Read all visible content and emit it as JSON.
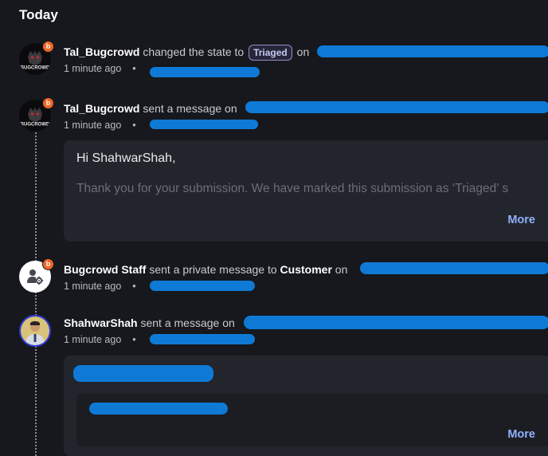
{
  "section": {
    "title": "Today"
  },
  "icons": {
    "badge_letter": "b"
  },
  "events": [
    {
      "actor": "Tal_Bugcrowd",
      "action": "changed the state to",
      "state": "Triaged",
      "on": "on",
      "time": "1 minute ago",
      "dot": "•"
    },
    {
      "actor": "Tal_Bugcrowd",
      "action": "sent a message on",
      "time": "1 minute ago",
      "dot": "•"
    },
    {
      "actor": "Bugcrowd Staff",
      "action": "sent a private message to",
      "recipient": "Customer",
      "on": "on",
      "time": "1 minute ago",
      "dot": "•"
    },
    {
      "actor": "ShahwarShah",
      "action": "sent a message on",
      "time": "1 minute ago",
      "dot": "•"
    }
  ],
  "message1": {
    "greeting": "Hi ShahwarShah,",
    "body": "Thank you for your submission. We have marked this submission as ‘Triaged’ s",
    "more": "More"
  },
  "message2": {
    "more": "More"
  },
  "colors": {
    "background": "#16181d",
    "card": "#22252b",
    "link": "#8fb1ff",
    "redaction": "#0f7ad6",
    "badge": "#f26522"
  }
}
